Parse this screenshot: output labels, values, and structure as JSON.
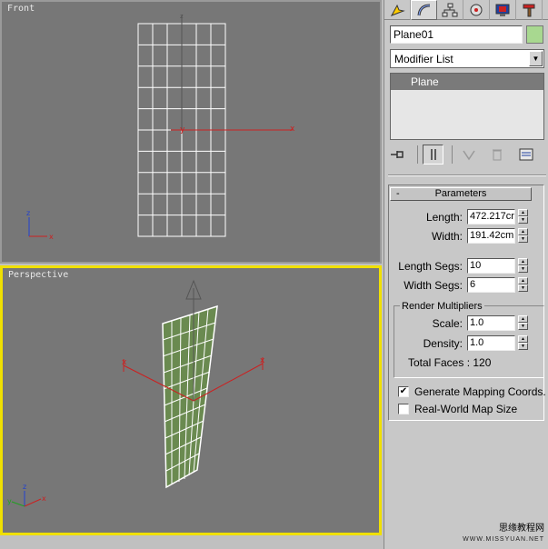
{
  "viewports": {
    "front": {
      "label": "Front"
    },
    "perspective": {
      "label": "Perspective"
    }
  },
  "panel": {
    "tabs": [
      {
        "icon": "create-icon"
      },
      {
        "icon": "modify-icon"
      },
      {
        "icon": "hierarchy-icon"
      },
      {
        "icon": "motion-icon"
      },
      {
        "icon": "display-icon"
      },
      {
        "icon": "utilities-icon"
      }
    ],
    "object_name": "Plane01",
    "object_color": "#a8d890",
    "modifier_list": "Modifier List",
    "stack_items": [
      "Plane"
    ],
    "parameters": {
      "title": "Parameters",
      "collapse_symbol": "-",
      "length_label": "Length:",
      "length_value": "472.217cr",
      "width_label": "Width:",
      "width_value": "191.42cm",
      "length_segs_label": "Length Segs:",
      "length_segs_value": "10",
      "width_segs_label": "Width Segs:",
      "width_segs_value": "6",
      "render_multipliers_title": "Render Multipliers",
      "scale_label": "Scale:",
      "scale_value": "1.0",
      "density_label": "Density:",
      "density_value": "1.0",
      "total_faces": "Total Faces : 120",
      "generate_mapping_label": "Generate Mapping Coords.",
      "generate_mapping_checked": true,
      "real_world_label": "Real-World Map Size",
      "real_world_checked": false
    }
  },
  "watermark": {
    "line1": "思缘教程网",
    "line2": "WWW.MISSYUAN.NET"
  },
  "colors": {
    "viewport_bg": "#777777",
    "active_border": "#f0e000",
    "axis_red": "#cc2020",
    "plane_green": "#6a8a50"
  }
}
